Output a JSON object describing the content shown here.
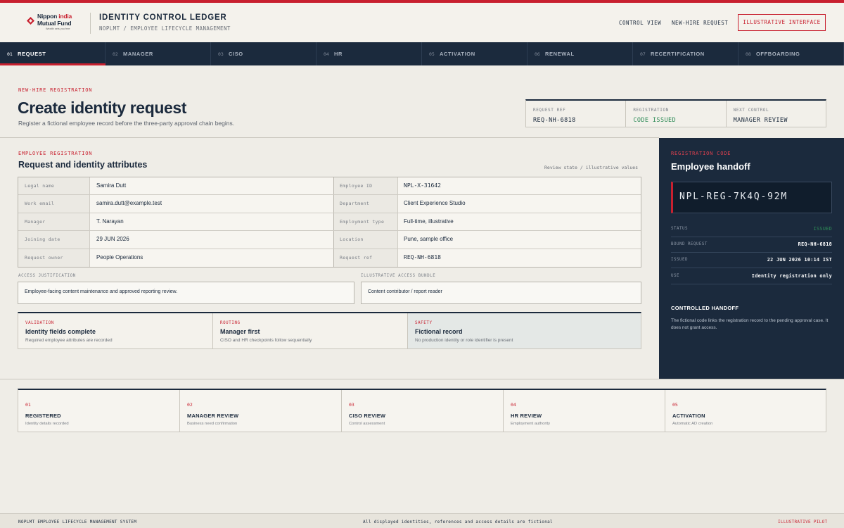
{
  "brand": {
    "logo_line1_a": "Nippon ",
    "logo_line1_b": "india",
    "logo_line2": "Mutual Fund",
    "logo_tagline": "Wealth sets you free"
  },
  "header": {
    "title": "IDENTITY CONTROL LEDGER",
    "subtitle": "NOPLMT / EMPLOYEE LIFECYCLE MANAGEMENT",
    "links": [
      "CONTROL VIEW",
      "NEW-HIRE REQUEST"
    ],
    "badge": "ILLUSTRATIVE INTERFACE"
  },
  "tabs": [
    {
      "num": "01",
      "label": "REQUEST"
    },
    {
      "num": "02",
      "label": "MANAGER"
    },
    {
      "num": "03",
      "label": "CISO"
    },
    {
      "num": "04",
      "label": "HR"
    },
    {
      "num": "05",
      "label": "ACTIVATION"
    },
    {
      "num": "06",
      "label": "RENEWAL"
    },
    {
      "num": "07",
      "label": "RECERTIFICATION"
    },
    {
      "num": "08",
      "label": "OFFBOARDING"
    }
  ],
  "hero": {
    "eyebrow": "NEW-HIRE REGISTRATION",
    "title": "Create identity request",
    "description": "Register a fictional employee record before the three-party approval chain begins.",
    "summary": [
      {
        "label": "REQUEST REF",
        "value": "REQ-NH-6818"
      },
      {
        "label": "REGISTRATION",
        "value": "CODE ISSUED"
      },
      {
        "label": "NEXT CONTROL",
        "value": "MANAGER REVIEW"
      }
    ]
  },
  "registration": {
    "eyebrow": "EMPLOYEE REGISTRATION",
    "title": "Request and identity attributes",
    "review_note": "Review state / illustrative values",
    "rows": [
      {
        "k1": "Legal name",
        "v1": "Samira Dutt",
        "k2": "Employee ID",
        "v2": "NPL-X-31642"
      },
      {
        "k1": "Work email",
        "v1": "samira.dutt@example.test",
        "k2": "Department",
        "v2": "Client Experience Studio"
      },
      {
        "k1": "Manager",
        "v1": "T. Narayan",
        "k2": "Employment type",
        "v2": "Full-time, illustrative"
      },
      {
        "k1": "Joining date",
        "v1": "29 JUN 2026",
        "k2": "Location",
        "v2": "Pune, sample office"
      },
      {
        "k1": "Request owner",
        "v1": "People Operations",
        "k2": "Request ref",
        "v2": "REQ-NH-6818"
      }
    ],
    "justification_label": "ACCESS JUSTIFICATION",
    "justification_value": "Employee-facing content maintenance and approved reporting review.",
    "bundle_label": "ILLUSTRATIVE ACCESS BUNDLE",
    "bundle_value": "Content contributor / report reader"
  },
  "checks": [
    {
      "eyebrow": "VALIDATION",
      "title": "Identity fields complete",
      "desc": "Required employee attributes are recorded"
    },
    {
      "eyebrow": "ROUTING",
      "title": "Manager first",
      "desc": "CISO and HR checkpoints follow sequentially"
    },
    {
      "eyebrow": "SAFETY",
      "title": "Fictional record",
      "desc": "No production identity or role identifier is present"
    }
  ],
  "handoff": {
    "eyebrow": "REGISTRATION CODE",
    "title": "Employee handoff",
    "code": "NPL-REG-7K4Q-92M",
    "rows": [
      {
        "label": "STATUS",
        "value": "ISSUED"
      },
      {
        "label": "BOUND REQUEST",
        "value": "REQ-NH-6818"
      },
      {
        "label": "ISSUED",
        "value": "22 JUN 2026 10:14 IST"
      },
      {
        "label": "USE",
        "value": "Identity registration only"
      }
    ],
    "heading": "CONTROLLED HANDOFF",
    "text": "The fictional code links the registration record to the pending approval case. It does not grant access."
  },
  "steps": [
    {
      "num": "01",
      "title": "REGISTERED",
      "desc": "Identity details recorded"
    },
    {
      "num": "02",
      "title": "MANAGER REVIEW",
      "desc": "Business need confirmation"
    },
    {
      "num": "03",
      "title": "CISO REVIEW",
      "desc": "Control assessment"
    },
    {
      "num": "04",
      "title": "HR REVIEW",
      "desc": "Employment authority"
    },
    {
      "num": "05",
      "title": "ACTIVATION",
      "desc": "Automatic AD creation"
    }
  ],
  "footer": {
    "left": "NOPLMT EMPLOYEE LIFECYCLE MANAGEMENT SYSTEM",
    "center": "All displayed identities, references and access details are fictional",
    "right": "ILLUSTRATIVE PILOT"
  },
  "colors": {
    "accent": "#c8202f",
    "navy": "#1b2a3d",
    "background": "#efede7",
    "success": "#2e8b57"
  }
}
